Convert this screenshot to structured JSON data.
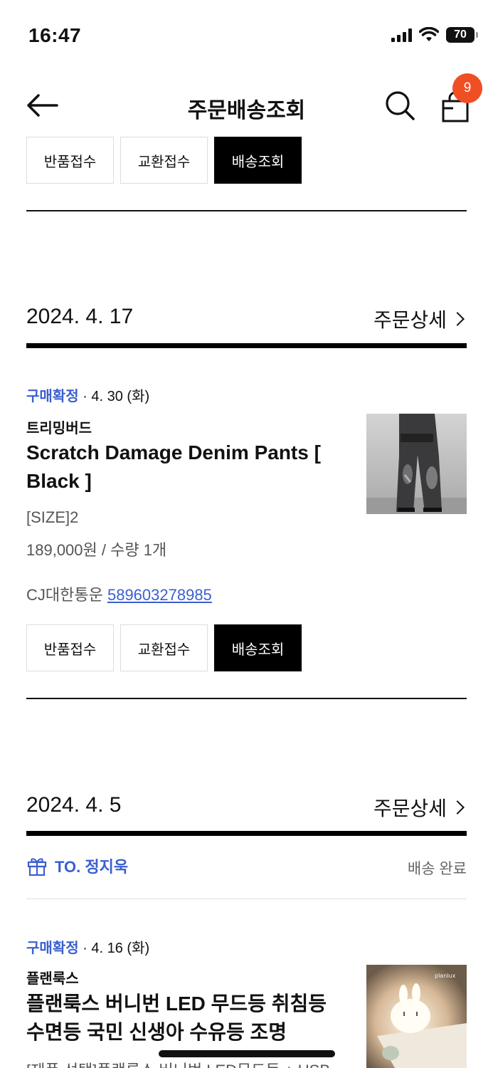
{
  "status_bar": {
    "time": "16:47",
    "battery": "70"
  },
  "header": {
    "title": "주문배송조회",
    "cart_count": "9"
  },
  "buttons": {
    "return": "반품접수",
    "exchange": "교환접수",
    "track": "배송조회"
  },
  "orders": [
    {
      "date": "2024. 4. 17",
      "detail_label": "주문상세",
      "status": "구매확정",
      "status_date": " · 4. 30 (화)",
      "brand": "트리밍버드",
      "product_name": "Scratch Damage Denim Pants [ Black ]",
      "option": "[SIZE]2",
      "price": "189,000원 / 수량 1개",
      "courier": "CJ대한통운 ",
      "tracking_number": "589603278985"
    },
    {
      "date": "2024. 4. 5",
      "detail_label": "주문상세",
      "gift_to": "TO. 정지욱",
      "delivery_status": "배송 완료",
      "status": "구매확정",
      "status_date": " · 4. 16 (화)",
      "brand": "플랜룩스",
      "product_name": "플랜룩스 버니번 LED 무드등 취침등 수면등 국민 신생아 수유등 조명",
      "option": "[제품 선택]플랜룩스 버니번 LED무드등 + USB",
      "thumb_logo": "planlux"
    }
  ],
  "colors": {
    "accent": "#3b5fd0",
    "badge": "#f04e23"
  }
}
